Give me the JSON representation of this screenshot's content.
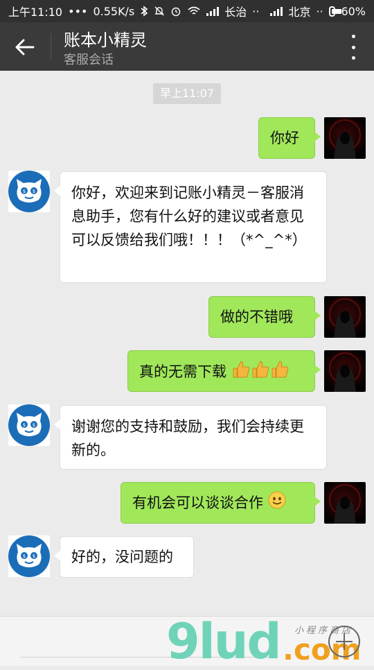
{
  "status_bar": {
    "time": "上午11:10",
    "net_speed": "0.55K/s",
    "carrier1": "长治",
    "carrier2": "北京",
    "battery": "60%",
    "battery_level": 0.6
  },
  "header": {
    "title": "账本小精灵",
    "subtitle": "客服会话"
  },
  "chat": {
    "time_stamp": "早上11:07",
    "messages": [
      {
        "from": "user",
        "text": "你好"
      },
      {
        "from": "bot",
        "text": "你好，欢迎来到记账小精灵－客服消息助手，您有什么好的建议或者意见可以反馈给我们哦！！！（*^_^*）"
      },
      {
        "from": "user",
        "text": "做的不错哦"
      },
      {
        "from": "user",
        "text": "真的无需下载"
      },
      {
        "from": "bot",
        "text": "谢谢您的支持和鼓励，我们会持续更新的。"
      },
      {
        "from": "user",
        "text": "有机会可以谈谈合作"
      },
      {
        "from": "bot",
        "text": "好的，没问题的"
      }
    ]
  },
  "watermark": {
    "brand": "9lud",
    "domain": ".com",
    "cn": "小程序商店"
  },
  "icons": {
    "back": "arrow-left-icon",
    "menu": "more-vertical-icon",
    "plus": "plus-circle-icon",
    "thumbs": "thumbs-up-icon",
    "smile": "smile-icon"
  }
}
